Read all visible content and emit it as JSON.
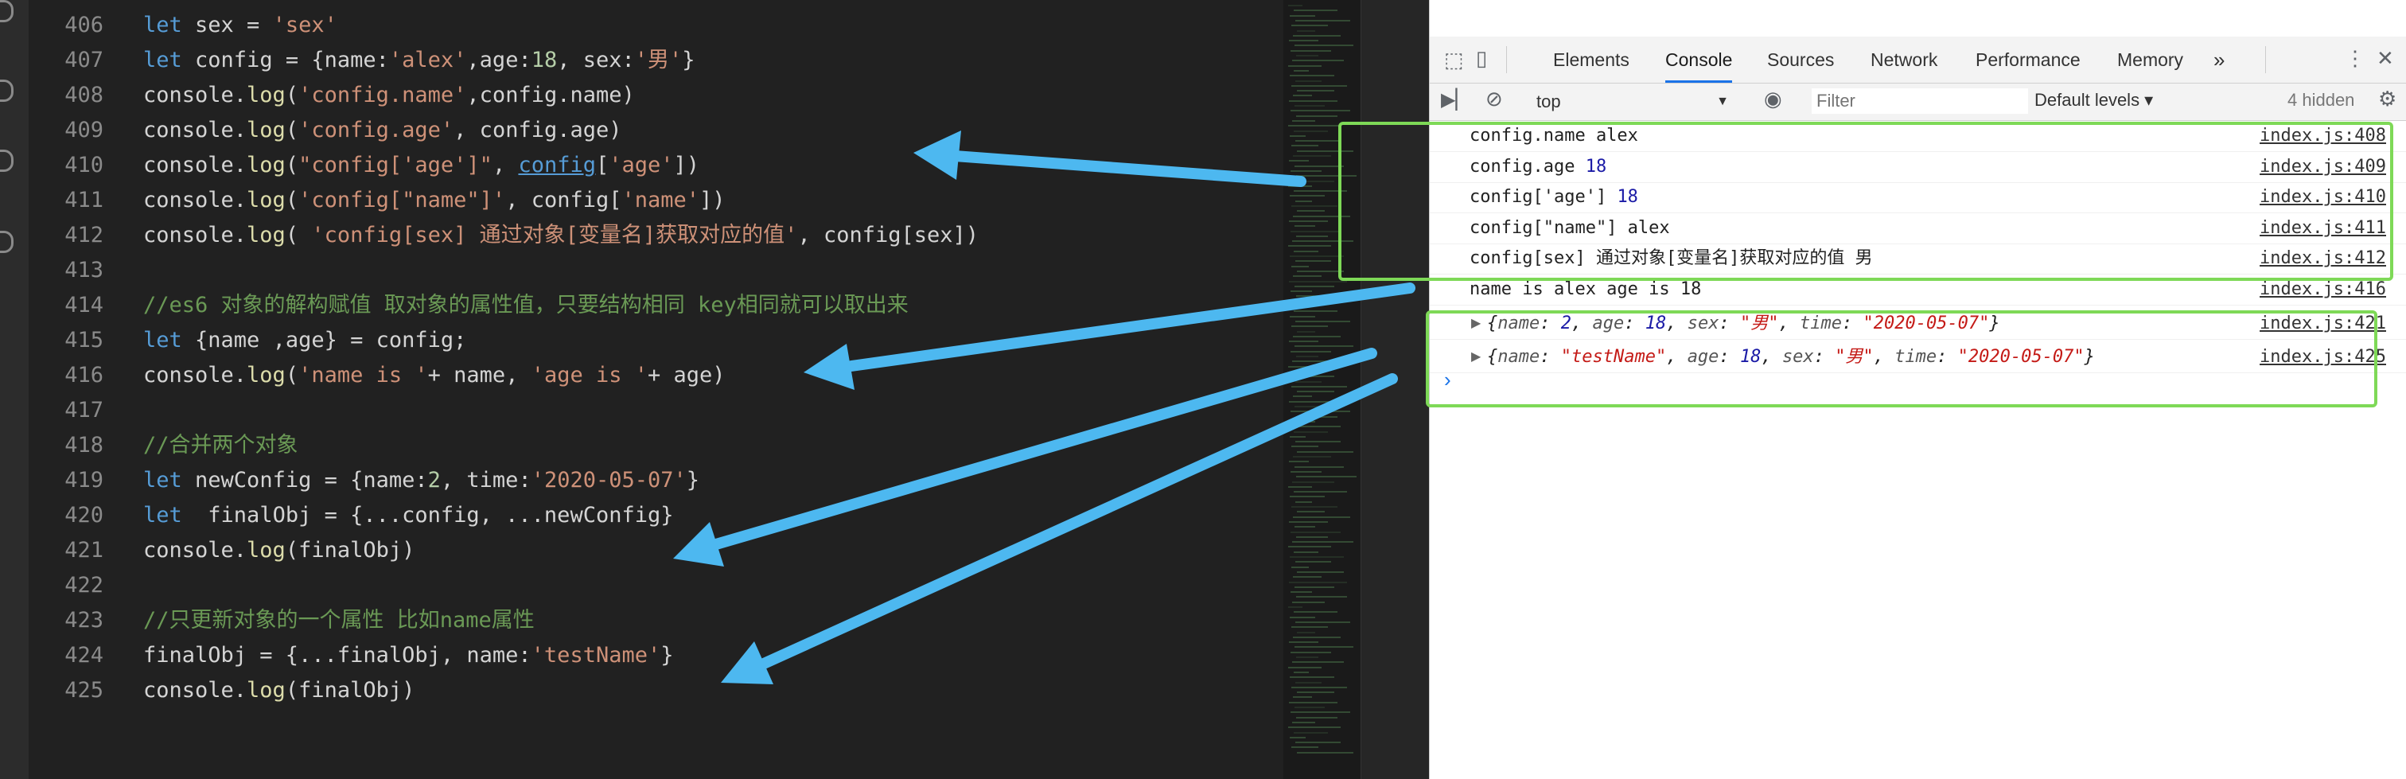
{
  "editor": {
    "lines": [
      {
        "n": "406",
        "tokens": [
          [
            "kw",
            "let"
          ],
          [
            "p",
            " sex = "
          ],
          [
            "st",
            "'sex'"
          ]
        ]
      },
      {
        "n": "407",
        "tokens": [
          [
            "kw",
            "let"
          ],
          [
            "p",
            " config = {name:"
          ],
          [
            "st",
            "'alex'"
          ],
          [
            "p",
            ",age:"
          ],
          [
            "nm",
            "18"
          ],
          [
            "p",
            ", sex:"
          ],
          [
            "st",
            "'男'"
          ],
          [
            "p",
            "}"
          ]
        ]
      },
      {
        "n": "408",
        "tokens": [
          [
            "p",
            "console."
          ],
          [
            "fn",
            "log"
          ],
          [
            "p",
            "("
          ],
          [
            "st",
            "'config.name'"
          ],
          [
            "p",
            ",config.name)"
          ]
        ]
      },
      {
        "n": "409",
        "tokens": [
          [
            "p",
            "console."
          ],
          [
            "fn",
            "log"
          ],
          [
            "p",
            "("
          ],
          [
            "st",
            "'config.age'"
          ],
          [
            "p",
            ", config.age)"
          ]
        ]
      },
      {
        "n": "410",
        "tokens": [
          [
            "p",
            "console."
          ],
          [
            "fn",
            "log"
          ],
          [
            "p",
            "("
          ],
          [
            "st",
            "\"config['age']\""
          ],
          [
            "p",
            ", "
          ],
          [
            "link",
            "config"
          ],
          [
            "p",
            "["
          ],
          [
            "st",
            "'age'"
          ],
          [
            "p",
            "])"
          ]
        ]
      },
      {
        "n": "411",
        "tokens": [
          [
            "p",
            "console."
          ],
          [
            "fn",
            "log"
          ],
          [
            "p",
            "("
          ],
          [
            "st",
            "'config[\"name\"]'"
          ],
          [
            "p",
            ", config["
          ],
          [
            "st",
            "'name'"
          ],
          [
            "p",
            "])"
          ]
        ]
      },
      {
        "n": "412",
        "tokens": [
          [
            "p",
            "console."
          ],
          [
            "fn",
            "log"
          ],
          [
            "p",
            "( "
          ],
          [
            "st",
            "'config[sex] 通过对象[变量名]获取对应的值'"
          ],
          [
            "p",
            ", config[sex])"
          ]
        ]
      },
      {
        "n": "413",
        "tokens": []
      },
      {
        "n": "414",
        "tokens": [
          [
            "cm",
            "//es6 对象的解构赋值 取对象的属性值，只要结构相同 key相同就可以取出来"
          ]
        ]
      },
      {
        "n": "415",
        "tokens": [
          [
            "kw",
            "let"
          ],
          [
            "p",
            " {name ,age} = config;"
          ]
        ]
      },
      {
        "n": "416",
        "tokens": [
          [
            "p",
            "console."
          ],
          [
            "fn",
            "log"
          ],
          [
            "p",
            "("
          ],
          [
            "st",
            "'name is '"
          ],
          [
            "p",
            "+ name, "
          ],
          [
            "st",
            "'age is '"
          ],
          [
            "p",
            "+ age)"
          ]
        ]
      },
      {
        "n": "417",
        "tokens": []
      },
      {
        "n": "418",
        "tokens": [
          [
            "cm",
            "//合并两个对象"
          ]
        ]
      },
      {
        "n": "419",
        "tokens": [
          [
            "kw",
            "let"
          ],
          [
            "p",
            " newConfig = {name:"
          ],
          [
            "nm",
            "2"
          ],
          [
            "p",
            ", time:"
          ],
          [
            "st",
            "'2020-05-07'"
          ],
          [
            "p",
            "}"
          ]
        ]
      },
      {
        "n": "420",
        "tokens": [
          [
            "kw",
            "let"
          ],
          [
            "p",
            "  finalObj = {...config, ...newConfig}"
          ]
        ]
      },
      {
        "n": "421",
        "tokens": [
          [
            "p",
            "console."
          ],
          [
            "fn",
            "log"
          ],
          [
            "p",
            "(finalObj)"
          ]
        ]
      },
      {
        "n": "422",
        "tokens": []
      },
      {
        "n": "423",
        "tokens": [
          [
            "cm",
            "//只更新对象的一个属性 比如name属性"
          ]
        ]
      },
      {
        "n": "424",
        "tokens": [
          [
            "p",
            "finalObj = {...finalObj, name:"
          ],
          [
            "st",
            "'testName'"
          ],
          [
            "p",
            "}"
          ]
        ]
      },
      {
        "n": "425",
        "tokens": [
          [
            "p",
            "console."
          ],
          [
            "fn",
            "log"
          ],
          [
            "p",
            "(finalObj)"
          ]
        ]
      }
    ]
  },
  "devtools": {
    "tabs": [
      "Elements",
      "Console",
      "Sources",
      "Network",
      "Performance",
      "Memory"
    ],
    "active_tab": "Console",
    "more_tabs": "»",
    "context": "top",
    "filter_placeholder": "Filter",
    "levels": "Default levels ▾",
    "hidden": "4 hidden",
    "messages": [
      {
        "text": "config.name alex",
        "src": "index.js:408"
      },
      {
        "text": "config.age ",
        "num": "18",
        "src": "index.js:409"
      },
      {
        "text": "config['age'] ",
        "num": "18",
        "src": "index.js:410"
      },
      {
        "text": "config[\"name\"] alex",
        "src": "index.js:411"
      },
      {
        "text": "config[sex] 通过对象[变量名]获取对应的值 男",
        "src": "index.js:412"
      },
      {
        "text": "name is alex age is 18",
        "src": "index.js:416"
      }
    ],
    "objects": [
      {
        "src": "index.js:421",
        "parts": [
          [
            "p",
            "{"
          ],
          [
            "key",
            "name"
          ],
          [
            "p",
            ": "
          ],
          [
            "num",
            "2"
          ],
          [
            "p",
            ", "
          ],
          [
            "key",
            "age"
          ],
          [
            "p",
            ": "
          ],
          [
            "num",
            "18"
          ],
          [
            "p",
            ", "
          ],
          [
            "key",
            "sex"
          ],
          [
            "p",
            ": "
          ],
          [
            "str",
            "\"男\""
          ],
          [
            "p",
            ", "
          ],
          [
            "key",
            "time"
          ],
          [
            "p",
            ": "
          ],
          [
            "str",
            "\"2020-05-07\""
          ],
          [
            "p",
            "}"
          ]
        ]
      },
      {
        "src": "index.js:425",
        "parts": [
          [
            "p",
            "{"
          ],
          [
            "key",
            "name"
          ],
          [
            "p",
            ": "
          ],
          [
            "str",
            "\"testName\""
          ],
          [
            "p",
            ", "
          ],
          [
            "key",
            "age"
          ],
          [
            "p",
            ": "
          ],
          [
            "num",
            "18"
          ],
          [
            "p",
            ", "
          ],
          [
            "key",
            "sex"
          ],
          [
            "p",
            ": "
          ],
          [
            "str",
            "\"男\""
          ],
          [
            "p",
            ", "
          ],
          [
            "key",
            "time"
          ],
          [
            "p",
            ": "
          ],
          [
            "str",
            "\"2020-05-07\""
          ],
          [
            "p",
            "}"
          ]
        ]
      }
    ],
    "prompt": "›"
  },
  "colors": {
    "highlight_box": "#7ed957",
    "arrow": "#4db8f0",
    "active_tab": "#1a73e8"
  },
  "icons": [
    "inspect-icon",
    "device-icon",
    "more-vert-icon",
    "close-icon",
    "sidebar-toggle-icon",
    "clear-console-icon",
    "eye-icon",
    "gear-icon",
    "expand-triangle-icon"
  ]
}
